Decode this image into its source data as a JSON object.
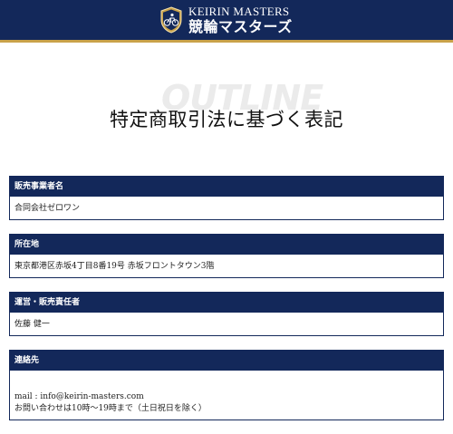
{
  "header": {
    "logo_en": "KEIRIN MASTERS",
    "logo_ja": "競輪マスターズ",
    "colors": {
      "navy": "#13285a",
      "gold": "#c9a24a"
    },
    "emblem_icon": "cyclist-shield-icon"
  },
  "title": {
    "watermark": "OUTLINE",
    "text": "特定商取引法に基づく表記"
  },
  "sections": [
    {
      "heading": "販売事業者名",
      "lines": [
        "合同会社ゼロワン"
      ]
    },
    {
      "heading": "所在地",
      "lines": [
        "東京都港区赤坂4丁目8番19号 赤坂フロントタウン3階"
      ]
    },
    {
      "heading": "運営・販売責任者",
      "lines": [
        "佐藤 健一"
      ]
    },
    {
      "heading": "連絡先",
      "lines": [
        "mail : info@keirin-masters.com",
        "お問い合わせは10時〜19時まで（土日祝日を除く）"
      ]
    }
  ]
}
